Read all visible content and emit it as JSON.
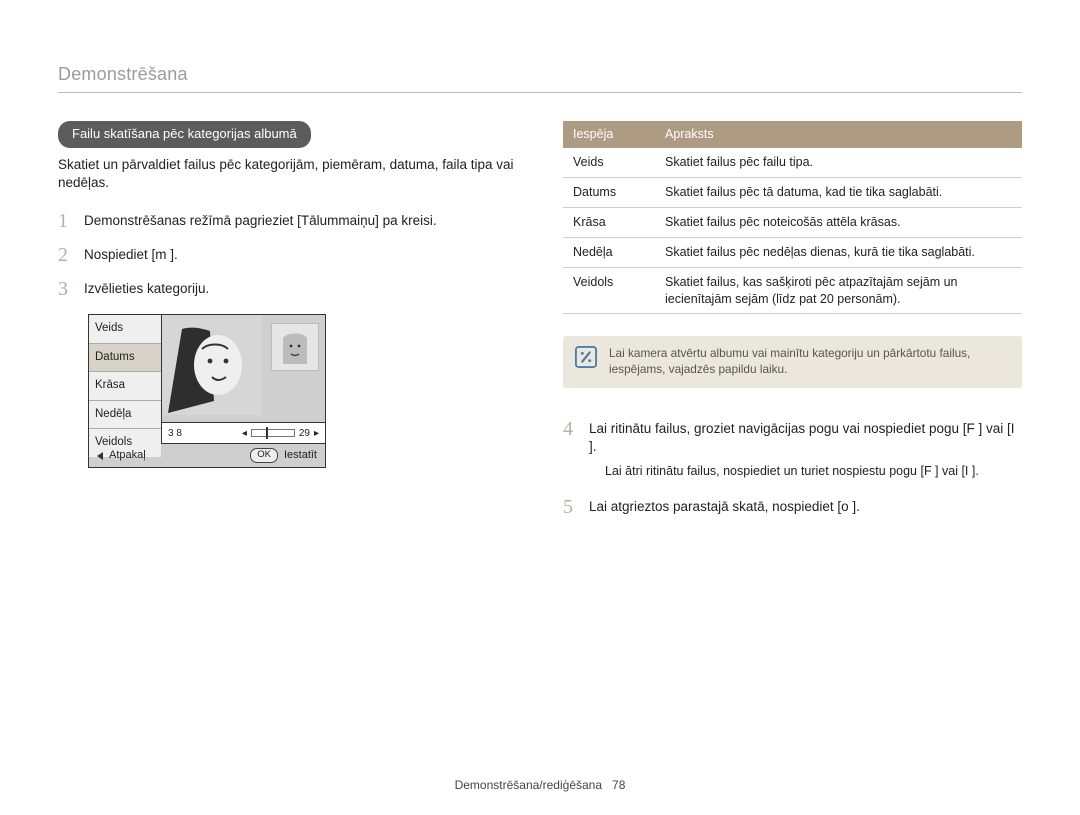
{
  "header": {
    "title": "Demonstrēšana"
  },
  "left": {
    "section_title": "Failu skatīšana pēc kategorijas albumā",
    "intro": "Skatiet un pārvaldiet failus pēc kategorijām, piemēram, datuma, faila tipa vai nedēļas.",
    "steps": [
      "Demonstrēšanas režīmā pagrieziet [Tālummaiņu] pa kreisi.",
      "Nospiediet [m     ].",
      "Izvēlieties kategoriju."
    ],
    "ui": {
      "list": [
        "Veids",
        "Datums",
        "Krāsa",
        "Nedēļa",
        "Veidols"
      ],
      "selected_index": 1,
      "bar_left": "3 8",
      "bar_right": "29",
      "footer_left": "Atpakaļ",
      "footer_right_btn": "OK",
      "footer_right": "Iestatīt"
    }
  },
  "right": {
    "table": {
      "head": [
        "Iespēja",
        "Apraksts"
      ],
      "rows": [
        [
          "Veids",
          "Skatiet failus pēc failu tipa."
        ],
        [
          "Datums",
          "Skatiet failus pēc tā datuma, kad tie tika saglabāti."
        ],
        [
          "Krāsa",
          "Skatiet failus pēc noteicošās attēla krāsas."
        ],
        [
          "Nedēļa",
          "Skatiet failus pēc nedēļas dienas, kurā tie tika saglabāti."
        ],
        [
          "Veidols",
          "Skatiet failus, kas sašķiroti pēc atpazītajām sejām un iecienītajām sejām (līdz pat 20 personām)."
        ]
      ]
    },
    "note": "Lai kamera atvērtu albumu vai mainītu kategoriju un pārkārtotu failus, iespējams, vajadzēs papildu laiku.",
    "step4": "Lai ritinātu failus, groziet navigācijas pogu vai nospiediet pogu [F ] vai [I     ].",
    "step4_bullet": "Lai ātri ritinātu failus, nospiediet un turiet nospiestu pogu [F ] vai [I     ].",
    "step5": "Lai atgrieztos parastajā skatā, nospiediet [o  ]."
  },
  "footer": {
    "text": "Demonstrēšana/rediģēšana",
    "page": "78"
  }
}
